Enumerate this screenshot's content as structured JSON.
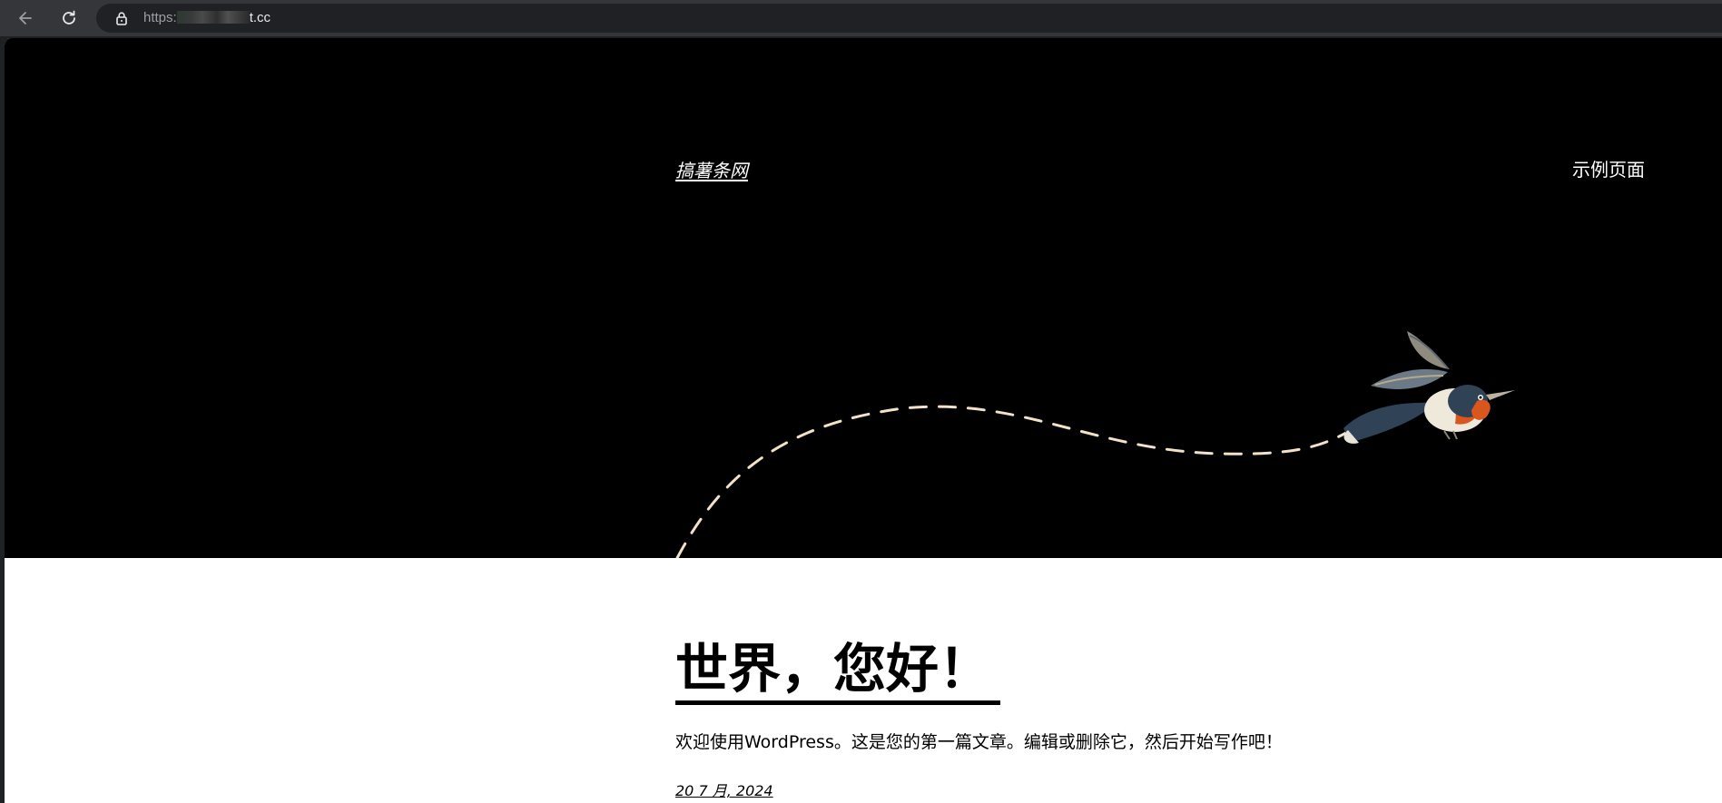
{
  "browser": {
    "url_scheme": "https:",
    "url_suffix": "t.cc",
    "icons": [
      "back-arrow-icon",
      "reload-icon",
      "lock-icon"
    ]
  },
  "header": {
    "site_title": "搞薯条网",
    "nav_items": [
      {
        "label": "示例页面"
      }
    ]
  },
  "post": {
    "title": "世界，您好！",
    "excerpt": "欢迎使用WordPress。这是您的第一篇文章。编辑或删除它，然后开始写作吧！",
    "date": "20 7 月, 2024"
  },
  "colors": {
    "hero_background": "#000000",
    "page_background": "#ffffff",
    "flight_path": "#f3e1c8",
    "bird_breast": "#d9561c",
    "bird_back": "#2f4256"
  }
}
